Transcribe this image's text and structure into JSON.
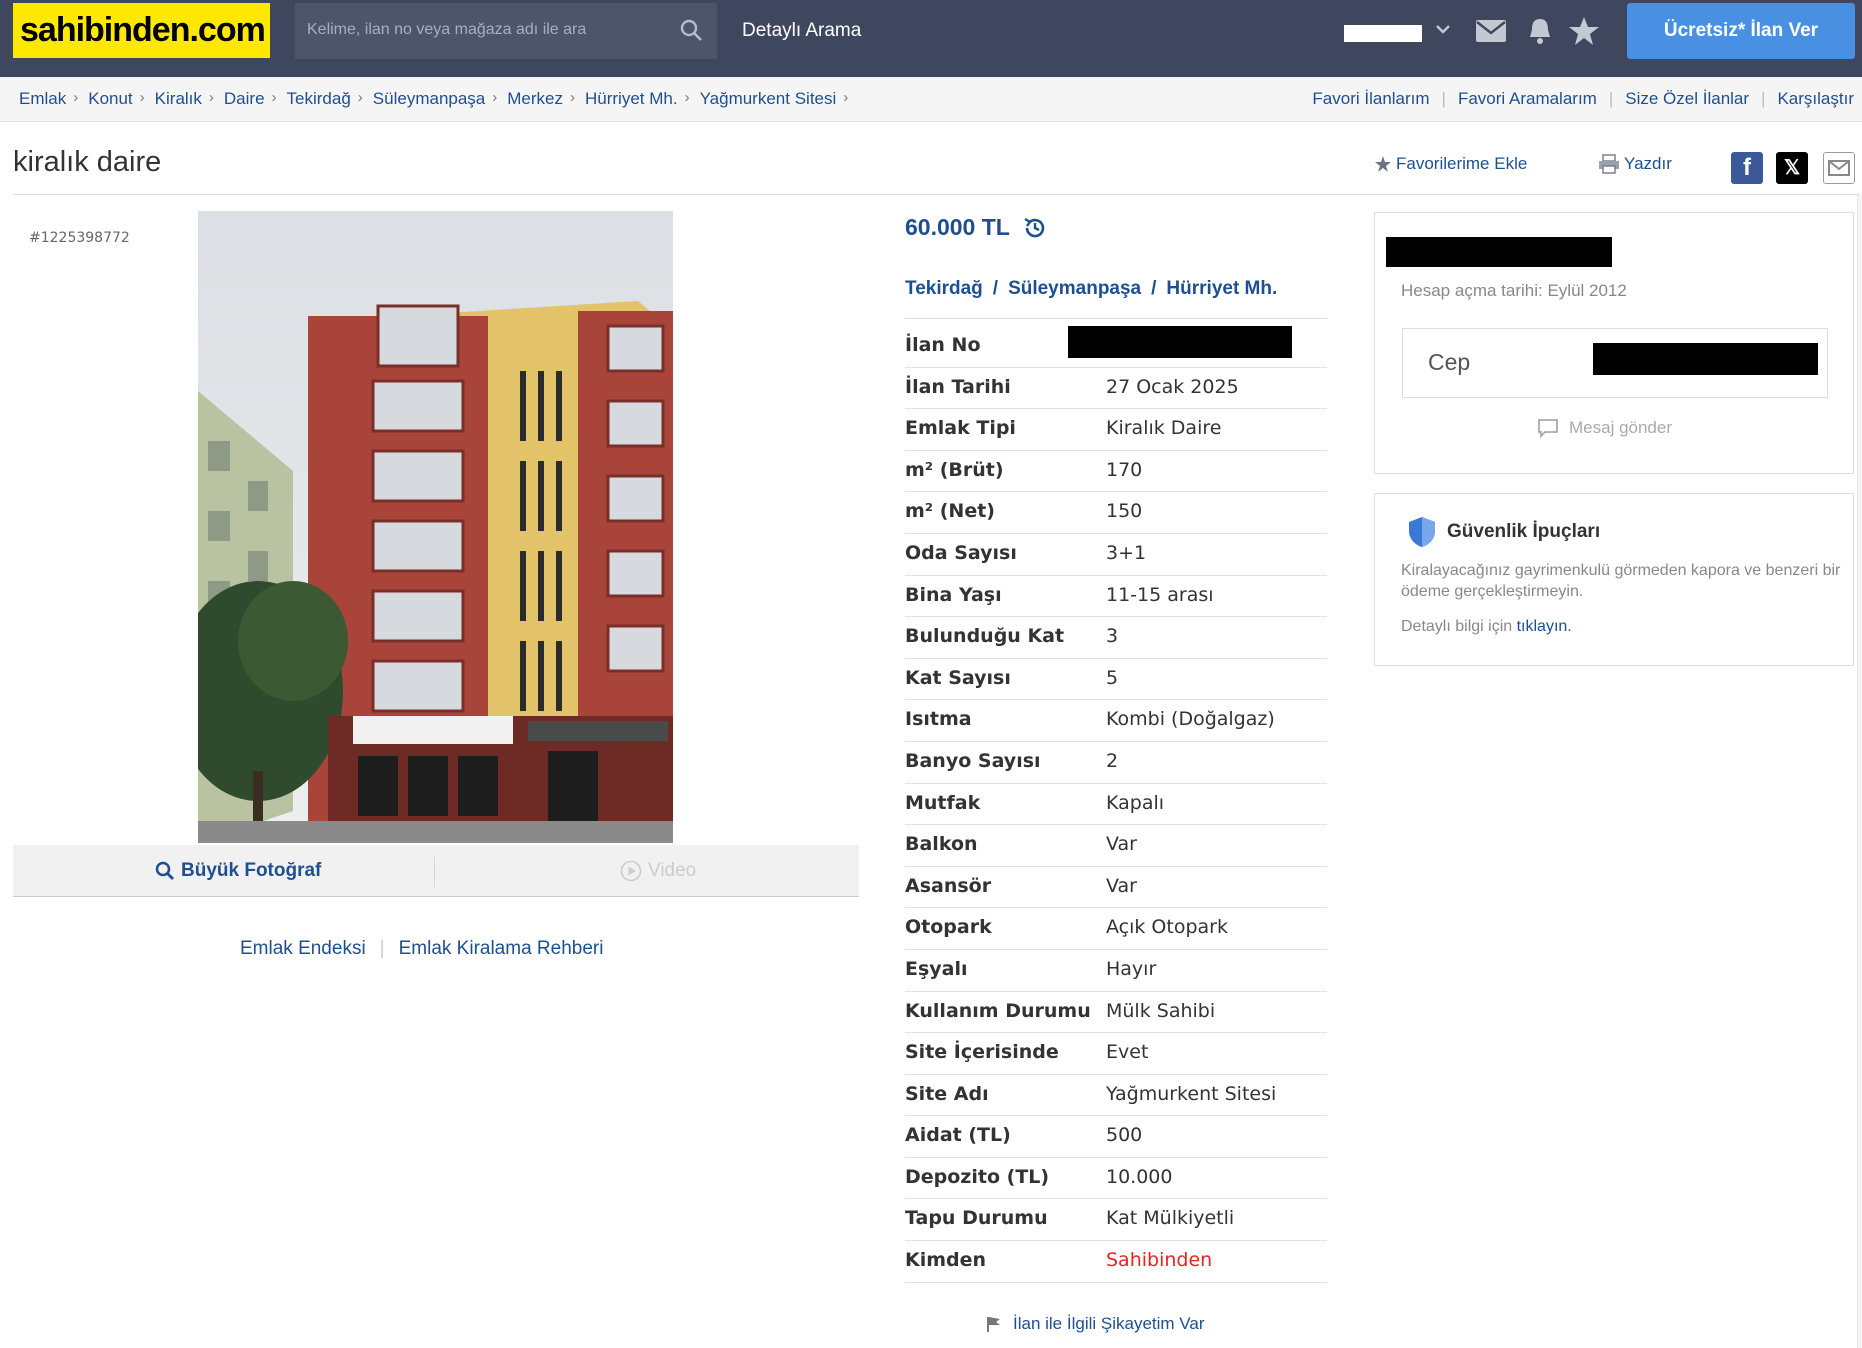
{
  "header": {
    "logo_text": "sahibinden.com",
    "search_placeholder": "Kelime, ilan no veya mağaza adı ile ara",
    "detailed_search": "Detaylı Arama",
    "post_button": "Ücretsiz* İlan Ver",
    "colors": {
      "bar": "#3f475f",
      "logo_bg": "#ffe800",
      "post_button": "#4a90e2"
    }
  },
  "breadcrumb": [
    "Emlak",
    "Konut",
    "Kiralık",
    "Daire",
    "Tekirdağ",
    "Süleymanpaşa",
    "Merkez",
    "Hürriyet Mh.",
    "Yağmurkent Sitesi"
  ],
  "quick_links": [
    "Favori İlanlarım",
    "Favori Aramalarım",
    "Size Özel İlanlar",
    "Karşılaştır"
  ],
  "listing": {
    "title": "kiralık daire",
    "favorite_label": "Favorilerime Ekle",
    "print_label": "Yazdır",
    "photo_number": "#1225398772",
    "big_photo_label": "Büyük Fotoğraf",
    "video_label": "Video",
    "guide_links": [
      "Emlak Endeksi",
      "Emlak Kiralama Rehberi"
    ],
    "price": "60.000 TL",
    "location": [
      "Tekirdağ",
      "Süleymanpaşa",
      "Hürriyet Mh."
    ],
    "details": [
      {
        "label": "İlan No",
        "value": ""
      },
      {
        "label": "İlan Tarihi",
        "value": "27 Ocak 2025"
      },
      {
        "label": "Emlak Tipi",
        "value": "Kiralık Daire"
      },
      {
        "label": "m² (Brüt)",
        "value": "170"
      },
      {
        "label": "m² (Net)",
        "value": "150"
      },
      {
        "label": "Oda Sayısı",
        "value": "3+1"
      },
      {
        "label": "Bina Yaşı",
        "value": "11-15 arası"
      },
      {
        "label": "Bulunduğu Kat",
        "value": "3"
      },
      {
        "label": "Kat Sayısı",
        "value": "5"
      },
      {
        "label": "Isıtma",
        "value": "Kombi (Doğalgaz)"
      },
      {
        "label": "Banyo Sayısı",
        "value": "2"
      },
      {
        "label": "Mutfak",
        "value": "Kapalı"
      },
      {
        "label": "Balkon",
        "value": "Var"
      },
      {
        "label": "Asansör",
        "value": "Var"
      },
      {
        "label": "Otopark",
        "value": "Açık Otopark"
      },
      {
        "label": "Eşyalı",
        "value": "Hayır"
      },
      {
        "label": "Kullanım Durumu",
        "value": "Mülk Sahibi"
      },
      {
        "label": "Site İçerisinde",
        "value": "Evet"
      },
      {
        "label": "Site Adı",
        "value": "Yağmurkent Sitesi"
      },
      {
        "label": "Aidat (TL)",
        "value": "500"
      },
      {
        "label": "Depozito (TL)",
        "value": "10.000"
      },
      {
        "label": "Tapu Durumu",
        "value": "Kat Mülkiyetli"
      },
      {
        "label": "Kimden",
        "value": "Sahibinden"
      }
    ],
    "complaint_label": "İlan ile İlgili Şikayetim Var"
  },
  "seller": {
    "since": "Hesap açma tarihi: Eylül 2012",
    "phone_label": "Cep",
    "message_label": "Mesaj gönder"
  },
  "tips": {
    "title": "Güvenlik İpuçları",
    "text": "Kiralayacağınız gayrimenkulü görmeden kapora ve benzeri bir ödeme gerçekleştirmeyin.",
    "more_prefix": "Detaylı bilgi için",
    "more_link": "tıklayın."
  }
}
